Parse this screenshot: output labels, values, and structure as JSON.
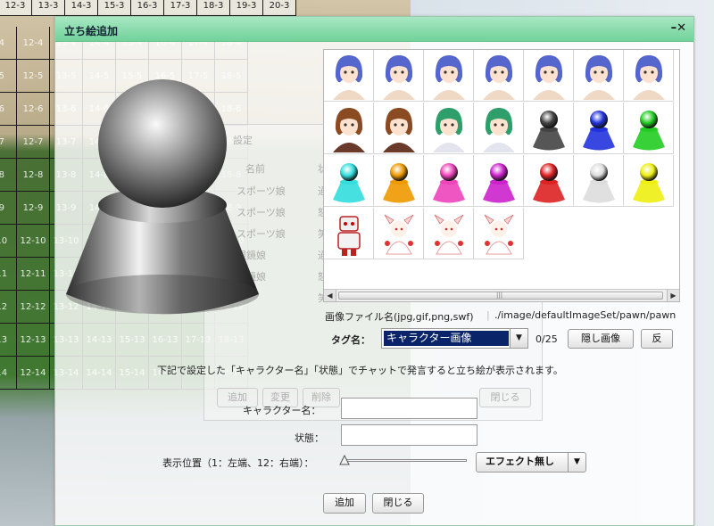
{
  "board": {
    "top_labels": [
      "12-3",
      "13-3",
      "14-3",
      "15-3",
      "16-3",
      "17-3",
      "18-3",
      "19-3",
      "20-3"
    ],
    "rows": [
      [
        "-4",
        "12-4",
        "13-4",
        "14-4",
        "15-4",
        "16-4",
        "17-4",
        "18-4"
      ],
      [
        "-5",
        "12-5",
        "13-5",
        "14-5",
        "15-5",
        "16-5",
        "17-5",
        "18-5"
      ],
      [
        "-6",
        "12-6",
        "13-6",
        "14-6",
        "15-6",
        "16-6",
        "17-6",
        "18-6"
      ],
      [
        "-7",
        "12-7",
        "13-7",
        "14-7",
        "15-7",
        "16-7",
        "17-7",
        "18-7"
      ],
      [
        "-8",
        "12-8",
        "13-8",
        "14-8",
        "15-8",
        "16-8",
        "17-8",
        "18-8"
      ],
      [
        "-9",
        "12-9",
        "13-9",
        "14-9",
        "15-9",
        "16-9",
        "17-9",
        "18-9"
      ],
      [
        "-10",
        "12-10",
        "13-10",
        "14-10",
        "15-10",
        "16-10",
        "17-10",
        "18-10"
      ],
      [
        "-11",
        "12-11",
        "13-11",
        "14-11",
        "15-11",
        "16-11",
        "17-11",
        "18-11"
      ],
      [
        "-12",
        "12-12",
        "13-12",
        "14-12",
        "15-12",
        "16-12",
        "17-12",
        "18-12"
      ],
      [
        "-13",
        "12-13",
        "13-13",
        "14-13",
        "15-13",
        "16-13",
        "17-13",
        "18-13"
      ],
      [
        "-14",
        "12-14",
        "13-14",
        "14-14",
        "15-14",
        "16-14",
        "17-14",
        "18-14"
      ]
    ]
  },
  "dialog": {
    "title": "立ち絵追加",
    "window_controls": "–✕",
    "file_label": "画像ファイル名(jpg,gif,png,swf)",
    "file_path": "./image/defaultImageSet/pawn/pawn",
    "tag_label": "タグ名：",
    "tag_value": "キャラクター画像",
    "count": "0/25",
    "hide_image_button": "隠し画像",
    "flip_button": "反",
    "instruction": "下記で設定した「キャラクター名」「状態」でチャットで発言すると立ち絵が表示されます。",
    "character_name_label": "キャラクター名：",
    "character_name_value": "",
    "state_label": "状態：",
    "state_value": "",
    "position_label": "表示位置（1：左端、12：右端）：",
    "effect_value": "エフェクト無し",
    "add_button": "追加",
    "close_button": "閉じる"
  },
  "ghost_panel": {
    "title": "設定",
    "column_name": "名前",
    "column_state": "状",
    "rows": [
      {
        "name": "スポーツ娘",
        "state": "通",
        "path": ""
      },
      {
        "name": "スポーツ娘",
        "state": "怒",
        "path": "image/stand/sports_angry."
      },
      {
        "name": "スポーツ娘",
        "state": "笑",
        "path": "image/stand/sports_smile."
      },
      {
        "name": "眼鏡娘",
        "state": "通",
        "path": "image/stand/glass_normal."
      },
      {
        "name": "眼鏡娘",
        "state": "怒り",
        "path": "image/stand/glass_angry.p"
      },
      {
        "name": "",
        "state": "笑",
        "path": ""
      }
    ],
    "buttons": [
      "追加",
      "変更",
      "削除",
      "閉じる"
    ]
  },
  "thumbnails": [
    {
      "kind": "anime-blue"
    },
    {
      "kind": "anime-blue"
    },
    {
      "kind": "anime-blue"
    },
    {
      "kind": "anime-blue"
    },
    {
      "kind": "anime-blue"
    },
    {
      "kind": "anime-blue"
    },
    {
      "kind": "anime-blue"
    },
    {
      "kind": "brown-girl"
    },
    {
      "kind": "brown-girl"
    },
    {
      "kind": "green-girl"
    },
    {
      "kind": "green-girl"
    },
    {
      "kind": "pawn",
      "color": "#444444"
    },
    {
      "kind": "pawn",
      "color": "#2233dd"
    },
    {
      "kind": "pawn",
      "color": "#22cc22"
    },
    {
      "kind": "pawn",
      "color": "#33dddd"
    },
    {
      "kind": "pawn",
      "color": "#ee9900"
    },
    {
      "kind": "pawn",
      "color": "#ee44bb"
    },
    {
      "kind": "pawn",
      "color": "#cc22cc"
    },
    {
      "kind": "pawn",
      "color": "#dd2222"
    },
    {
      "kind": "pawn",
      "color": "#dddddd"
    },
    {
      "kind": "pawn",
      "color": "#eeee11"
    },
    {
      "kind": "robot"
    },
    {
      "kind": "fairy"
    },
    {
      "kind": "fairy"
    },
    {
      "kind": "fairy"
    }
  ]
}
